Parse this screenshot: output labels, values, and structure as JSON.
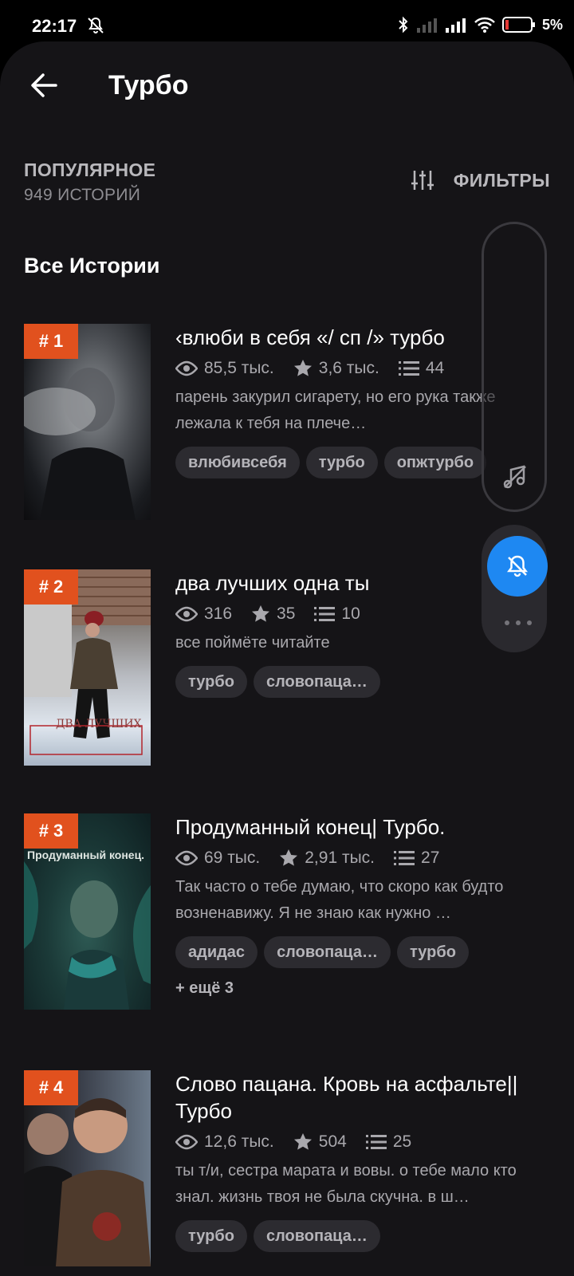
{
  "status": {
    "time": "22:17",
    "battery": "5%"
  },
  "header": {
    "title": "Турбо"
  },
  "section": {
    "label": "ПОПУЛЯРНОЕ",
    "count": "949 ИСТОРИЙ"
  },
  "filters": {
    "label": "ФИЛЬТРЫ"
  },
  "list_title": "Все Истории",
  "stories": [
    {
      "rank": "# 1",
      "title": "‹влюби в себя «/ сп /» турбо",
      "views": "85,5 тыс.",
      "votes": "3,6 тыс.",
      "parts": "44",
      "desc": "парень закурил сигарету, но его рука также лежала к тебя на плече…",
      "tags": [
        "влюбивсебя",
        "турбо",
        "опжтурбо"
      ]
    },
    {
      "rank": "# 2",
      "title": "два лучших одна ты",
      "views": "316",
      "votes": "35",
      "parts": "10",
      "desc": "все поймёте читайте",
      "tags": [
        "турбо",
        "словопаца…"
      ],
      "cover_text": "ДВА ЛУЧШИХ"
    },
    {
      "rank": "# 3",
      "title": "Продуманный конец| Турбо.",
      "views": "69 тыс.",
      "votes": "2,91 тыс.",
      "parts": "27",
      "desc": "Так часто о тебе думаю, что скоро как будто возненавижу. Я не знаю как нужно …",
      "tags": [
        "адидас",
        "словопаца…",
        "турбо"
      ],
      "more": "+ ещё 3",
      "cover_text": "Продуманный конец."
    },
    {
      "rank": "# 4",
      "title": "Слово пацана. Кровь на асфальте||Турбо",
      "views": "12,6 тыс.",
      "votes": "504",
      "parts": "25",
      "desc": "ты т/и, сестра марата и вовы. о тебе мало кто знал. жизнь твоя не была скучна. в ш…",
      "tags": [
        "турбо",
        "словопаца…"
      ]
    }
  ],
  "colors": {
    "background": "#151417",
    "rank_badge": "#e1511e",
    "fab": "#1e88f2",
    "tag_bg": "#2c2b30"
  },
  "icons": [
    "back-arrow-icon",
    "sliders-icon",
    "eye-icon",
    "star-icon",
    "list-icon",
    "music-off-icon",
    "bell-off-icon",
    "more-dots-icon"
  ]
}
